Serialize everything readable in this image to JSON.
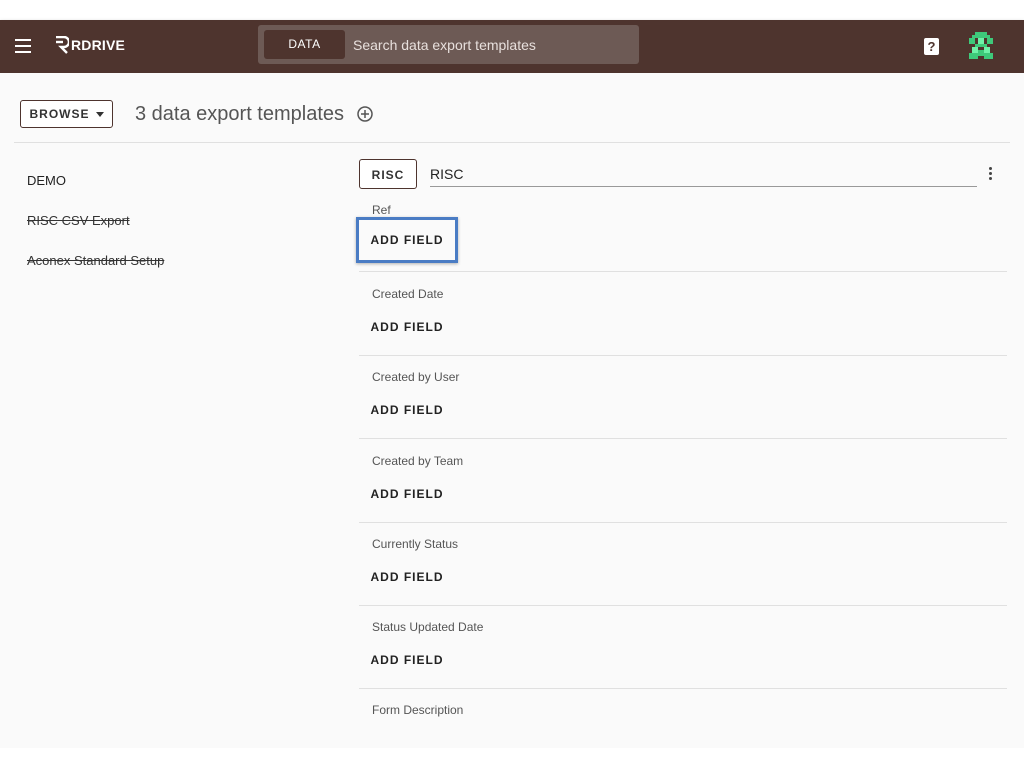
{
  "header": {
    "logo_text": "RDRIVE",
    "search_chip": "DATA",
    "search_placeholder": "Search data export templates"
  },
  "toolbar": {
    "browse_label": "BROWSE",
    "title": "3 data export templates"
  },
  "templates": [
    {
      "name": "DEMO",
      "struck": false
    },
    {
      "name": "RISC CSV Export",
      "struck": true
    },
    {
      "name": "Aconex Standard Setup",
      "struck": true
    }
  ],
  "editor": {
    "chip_label": "RISC",
    "name_value": "RISC",
    "add_field_label": "ADD FIELD",
    "fields": [
      "Ref",
      "Created Date",
      "Created by User",
      "Created by Team",
      "Currently Status",
      "Status Updated Date",
      "Form Description"
    ]
  },
  "colors": {
    "appbar": "#4e342e",
    "focus_outline": "#4a7cc4"
  }
}
